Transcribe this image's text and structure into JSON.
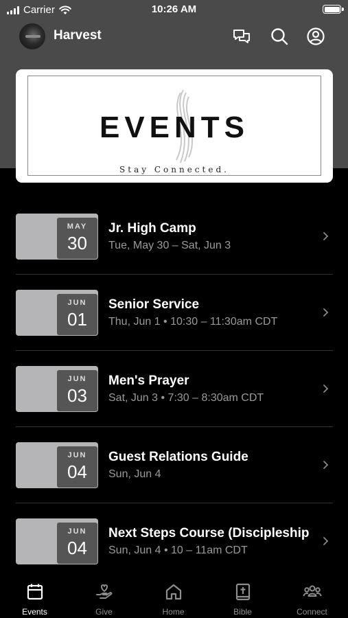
{
  "status_bar": {
    "carrier": "Carrier",
    "time": "10:26 AM"
  },
  "header": {
    "title": "Harvest",
    "icons": [
      "chat-icon",
      "search-icon",
      "account-icon"
    ]
  },
  "banner": {
    "title": "EVENTS",
    "subtitle": "Stay Connected."
  },
  "events": [
    {
      "month": "MAY",
      "day": "30",
      "title": "Jr. High Camp",
      "subtitle": "Tue, May 30 – Sat, Jun 3"
    },
    {
      "month": "JUN",
      "day": "01",
      "title": "Senior Service",
      "subtitle": "Thu, Jun 1 • 10:30 – 11:30am CDT"
    },
    {
      "month": "JUN",
      "day": "03",
      "title": "Men's Prayer",
      "subtitle": "Sat, Jun 3 • 7:30 – 8:30am CDT"
    },
    {
      "month": "JUN",
      "day": "04",
      "title": "Guest Relations Guide",
      "subtitle": "Sun, Jun 4"
    },
    {
      "month": "JUN",
      "day": "04",
      "title": "Next Steps Course (Discipleship",
      "subtitle": "Sun, Jun 4 • 10 – 11am CDT"
    }
  ],
  "tabs": [
    {
      "label": "Events",
      "icon": "calendar-icon",
      "active": true
    },
    {
      "label": "Give",
      "icon": "give-icon",
      "active": false
    },
    {
      "label": "Home",
      "icon": "home-icon",
      "active": false
    },
    {
      "label": "Bible",
      "icon": "bible-icon",
      "active": false
    },
    {
      "label": "Connect",
      "icon": "connect-icon",
      "active": false
    }
  ],
  "colors": {
    "background": "#000000",
    "header_background": "#4a4a4a",
    "date_card": "#b5b5b8",
    "date_box": "#555555",
    "secondary_text": "#9a9a9a",
    "inactive_tab": "#8e8e8e"
  }
}
